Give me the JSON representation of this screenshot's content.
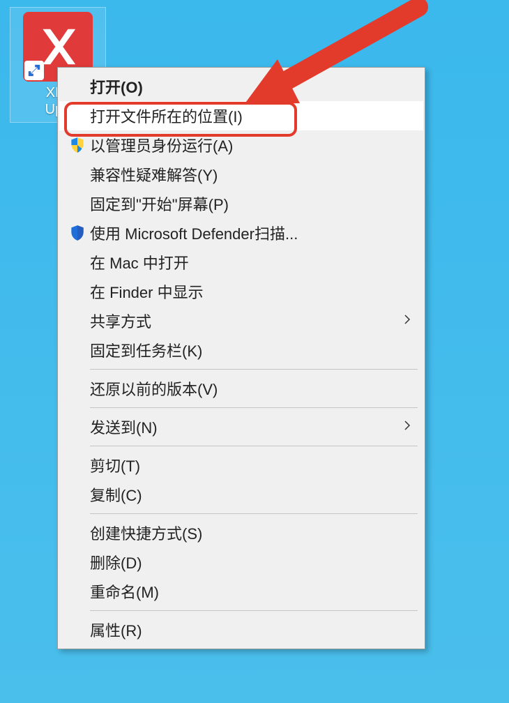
{
  "desktop_icon": {
    "label_line1": "XMi",
    "label_line2": "Upd"
  },
  "context_menu": {
    "open": "打开(O)",
    "open_file_location": "打开文件所在的位置(I)",
    "run_as_admin": "以管理员身份运行(A)",
    "compat_troubleshoot": "兼容性疑难解答(Y)",
    "pin_to_start": "固定到\"开始\"屏幕(P)",
    "defender_scan": "使用 Microsoft Defender扫描...",
    "open_in_mac": "在 Mac 中打开",
    "show_in_finder": "在 Finder 中显示",
    "share": "共享方式",
    "pin_to_taskbar": "固定到任务栏(K)",
    "restore_versions": "还原以前的版本(V)",
    "send_to": "发送到(N)",
    "cut": "剪切(T)",
    "copy": "复制(C)",
    "create_shortcut": "创建快捷方式(S)",
    "delete": "删除(D)",
    "rename": "重命名(M)",
    "properties": "属性(R)"
  },
  "annotation": {
    "highlighted_item": "open_file_location"
  }
}
